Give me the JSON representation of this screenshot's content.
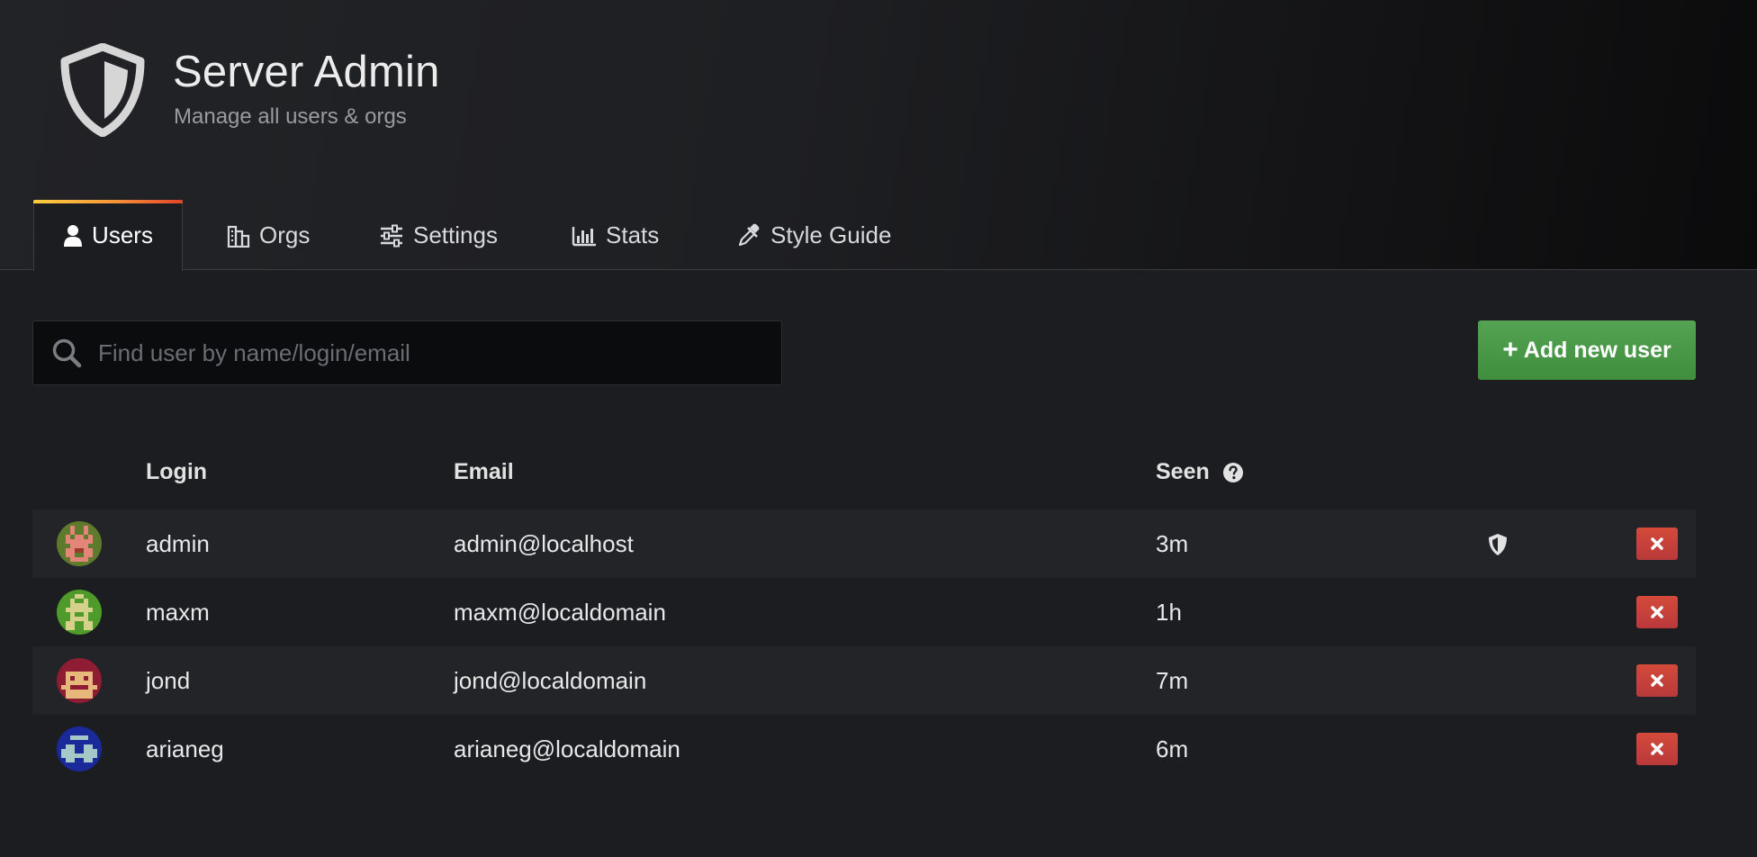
{
  "header": {
    "title": "Server Admin",
    "subtitle": "Manage all users & orgs",
    "icon": "shield-icon"
  },
  "tabs": [
    {
      "label": "Users",
      "icon": "user-icon",
      "active": true
    },
    {
      "label": "Orgs",
      "icon": "building-icon",
      "active": false
    },
    {
      "label": "Settings",
      "icon": "sliders-icon",
      "active": false
    },
    {
      "label": "Stats",
      "icon": "bar-chart-icon",
      "active": false
    },
    {
      "label": "Style Guide",
      "icon": "eyedropper-icon",
      "active": false
    }
  ],
  "toolbar": {
    "search_placeholder": "Find user by name/login/email",
    "search_value": "",
    "add_button_label": "Add new user"
  },
  "table": {
    "columns": {
      "login": "Login",
      "email": "Email",
      "seen": "Seen"
    },
    "rows": [
      {
        "login": "admin",
        "email": "admin@localhost",
        "seen": "3m",
        "is_admin": true
      },
      {
        "login": "maxm",
        "email": "maxm@localdomain",
        "seen": "1h",
        "is_admin": false
      },
      {
        "login": "jond",
        "email": "jond@localdomain",
        "seen": "7m",
        "is_admin": false
      },
      {
        "login": "arianeg",
        "email": "arianeg@localdomain",
        "seen": "6m",
        "is_admin": false
      }
    ]
  },
  "colors": {
    "accent_green": "#489c47",
    "danger_red": "#c8403a",
    "tab_gradient_start": "#fbcf3e",
    "tab_gradient_end": "#e2442a"
  }
}
